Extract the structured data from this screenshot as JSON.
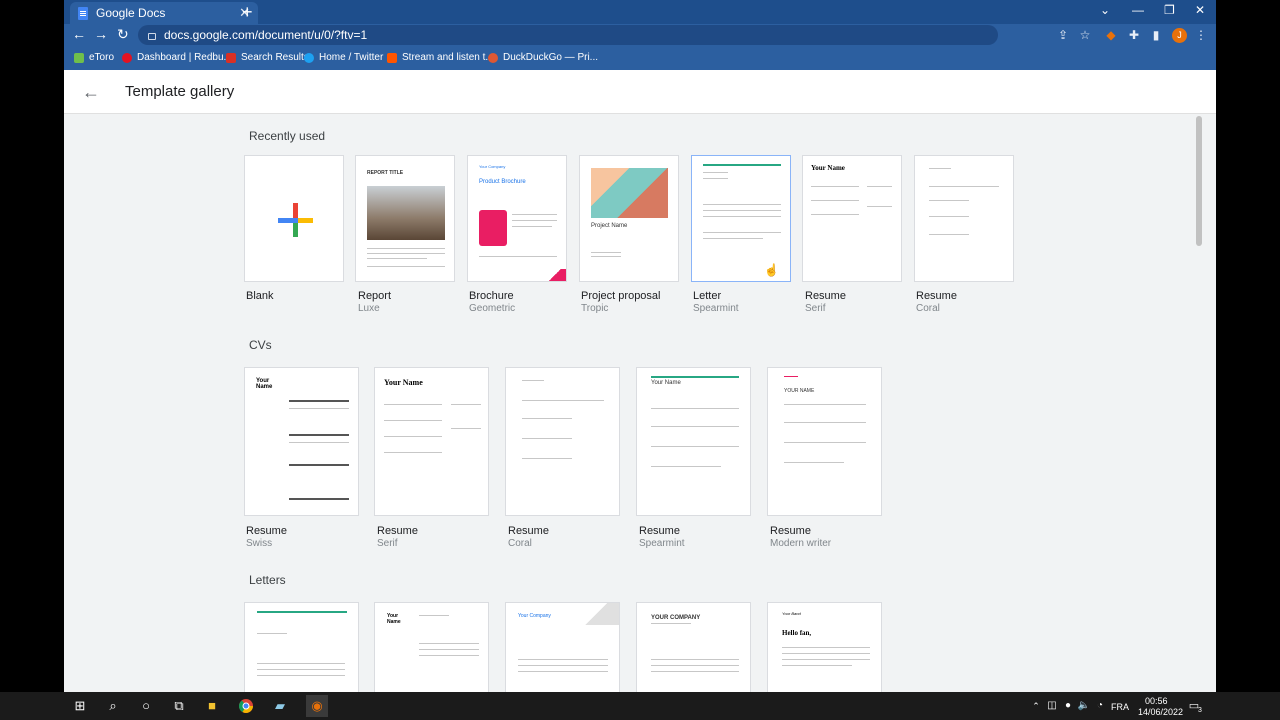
{
  "browser": {
    "tab_title": "Google Docs",
    "url": "docs.google.com/document/u/0/?ftv=1",
    "avatar_letter": "J",
    "bookmarks": [
      "eToro",
      "Dashboard | Redbu...",
      "Search Results",
      "Home / Twitter",
      "Stream and listen t...",
      "DuckDuckGo — Pri..."
    ]
  },
  "page": {
    "title": "Template gallery"
  },
  "sections": [
    {
      "title": "Recently used",
      "cards": [
        {
          "title": "Blank",
          "subtitle": ""
        },
        {
          "title": "Report",
          "subtitle": "Luxe",
          "thumb_text": "REPORT TITLE"
        },
        {
          "title": "Brochure",
          "subtitle": "Geometric",
          "thumb_text": "Product Brochure",
          "thumb_text2": "Your Company"
        },
        {
          "title": "Project proposal",
          "subtitle": "Tropic",
          "thumb_text": "Project Name"
        },
        {
          "title": "Letter",
          "subtitle": "Spearmint"
        },
        {
          "title": "Resume",
          "subtitle": "Serif",
          "thumb_text": "Your Name"
        },
        {
          "title": "Resume",
          "subtitle": "Coral"
        }
      ]
    },
    {
      "title": "CVs",
      "cards": [
        {
          "title": "Resume",
          "subtitle": "Swiss",
          "thumb_text": "Your Name"
        },
        {
          "title": "Resume",
          "subtitle": "Serif",
          "thumb_text": "Your Name"
        },
        {
          "title": "Resume",
          "subtitle": "Coral"
        },
        {
          "title": "Resume",
          "subtitle": "Spearmint",
          "thumb_text": "Your Name"
        },
        {
          "title": "Resume",
          "subtitle": "Modern writer",
          "thumb_text": "YOUR NAME"
        }
      ]
    },
    {
      "title": "Letters",
      "cards": [
        {
          "thumb_text": ""
        },
        {
          "thumb_text": "Your Name"
        },
        {
          "thumb_text": "Your Company"
        },
        {
          "thumb_text": "YOUR COMPANY"
        },
        {
          "thumb_text": "Hello fan,",
          "thumb_text2": "Your Band"
        }
      ]
    }
  ],
  "taskbar": {
    "time": "00:56",
    "date": "14/06/2022",
    "lang": "FRA",
    "notif_count": "3"
  }
}
